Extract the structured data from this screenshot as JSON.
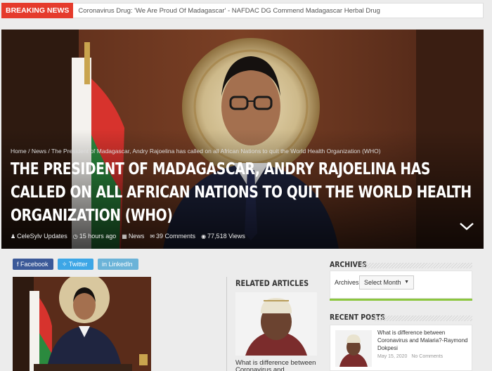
{
  "breaking": {
    "label": "BREAKING NEWS",
    "headline": "Coronavirus Drug: 'We Are Proud Of Madagascar' - NAFDAC DG Commend Madagascar Herbal Drug"
  },
  "hero": {
    "breadcrumb": {
      "home": "Home",
      "sep": "/",
      "section": "News",
      "current": "The President of Madagascar, Andry Rajoelina has called on all African Nations to quit the World Health Organization (WHO)"
    },
    "title": "The President of Madagascar, Andry Rajoelina has called on all African Nations to quit the World Health Organization (WHO)",
    "meta": {
      "author": "CeleSylv Updates",
      "time": "15 hours ago",
      "category": "News",
      "comments": "39 Comments",
      "views": "77,518 Views"
    }
  },
  "social": {
    "facebook": "Facebook",
    "twitter": "Twitter",
    "linkedin": "LinkedIn"
  },
  "related": {
    "heading": "RELATED ARTICLES",
    "item_title": "What is difference between Coronavirus and"
  },
  "sidebar": {
    "archives": {
      "heading": "ARCHIVES",
      "label": "Archives",
      "select_value": "Select Month"
    },
    "recent": {
      "heading": "RECENT POSTS",
      "post_title": "What is difference between Coronavirus and Malaria?-Raymond Dokpesi",
      "post_date": "May 15, 2020",
      "post_comments": "No Comments"
    }
  },
  "colors": {
    "breaking_red": "#e53b2c",
    "facebook": "#3b5998",
    "twitter": "#3da6e6",
    "linkedin": "#6bb3d8",
    "accent_green": "#8cc63f"
  },
  "icons": {
    "author": "user-icon",
    "time": "clock-icon",
    "category": "folder-icon",
    "comments": "comments-icon",
    "views": "eye-icon",
    "scroll": "chevron-down-icon"
  }
}
